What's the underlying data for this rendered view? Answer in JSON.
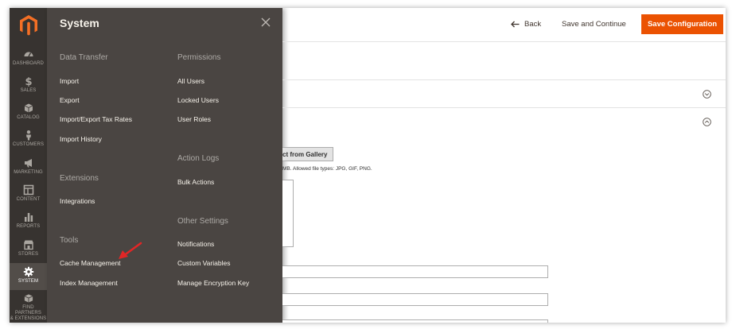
{
  "sidebar": {
    "items": [
      {
        "label": "DASHBOARD",
        "icon": "dashboard-icon"
      },
      {
        "label": "SALES",
        "icon": "dollar-icon"
      },
      {
        "label": "CATALOG",
        "icon": "cube-icon"
      },
      {
        "label": "CUSTOMERS",
        "icon": "person-icon"
      },
      {
        "label": "MARKETING",
        "icon": "megaphone-icon"
      },
      {
        "label": "CONTENT",
        "icon": "layout-icon"
      },
      {
        "label": "REPORTS",
        "icon": "bar-chart-icon"
      },
      {
        "label": "STORES",
        "icon": "storefront-icon"
      },
      {
        "label": "SYSTEM",
        "icon": "gear-icon",
        "active": true
      },
      {
        "label": "FIND PARTNERS",
        "label2": "& EXTENSIONS",
        "icon": "box-icon"
      }
    ]
  },
  "flyout": {
    "title": "System",
    "sections": {
      "data_transfer": {
        "title": "Data Transfer",
        "items": [
          "Import",
          "Export",
          "Import/Export Tax Rates",
          "Import History"
        ]
      },
      "extensions": {
        "title": "Extensions",
        "items": [
          "Integrations"
        ]
      },
      "tools": {
        "title": "Tools",
        "items": [
          "Cache Management",
          "Index Management"
        ]
      },
      "permissions": {
        "title": "Permissions",
        "items": [
          "All Users",
          "Locked Users",
          "User Roles"
        ]
      },
      "action_logs": {
        "title": "Action Logs",
        "items": [
          "Bulk Actions"
        ]
      },
      "other_settings": {
        "title": "Other Settings",
        "items": [
          "Notifications",
          "Custom Variables",
          "Manage Encryption Key"
        ]
      }
    }
  },
  "toolbar": {
    "back_label": "Back",
    "save_continue_label": "Save and Continue",
    "save_config_label": "Save Configuration"
  },
  "content": {
    "gallery_button_label": "ct from Gallery",
    "file_types_text": "MB. Allowed file types: JPG, GIF, PNG."
  },
  "colors": {
    "sidebar_bg": "#373330",
    "flyout_bg": "#4a4542",
    "accent": "#eb5202",
    "annotation_arrow": "#e22626"
  }
}
